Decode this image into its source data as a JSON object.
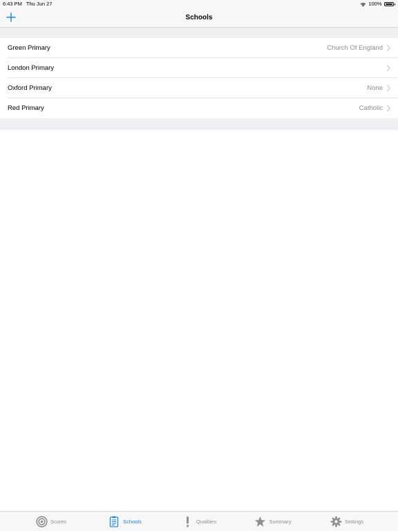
{
  "status_bar": {
    "time": "6:43 PM",
    "date": "Thu Jun 27",
    "battery_percent": "100%",
    "battery_level": 1.0
  },
  "nav": {
    "title": "Schools",
    "add_icon": "plus-icon"
  },
  "schools": [
    {
      "name": "Green Primary",
      "detail": "Church Of England"
    },
    {
      "name": "London Primary",
      "detail": ""
    },
    {
      "name": "Oxford Primary",
      "detail": "None"
    },
    {
      "name": "Red Primary",
      "detail": "Catholic"
    }
  ],
  "tabs": [
    {
      "label": "Scores",
      "icon": "target-icon",
      "active": false
    },
    {
      "label": "Schools",
      "icon": "clipboard-icon",
      "active": true
    },
    {
      "label": "Qualities",
      "icon": "exclamation-icon",
      "active": false
    },
    {
      "label": "Summary",
      "icon": "star-icon",
      "active": false
    },
    {
      "label": "Settings",
      "icon": "gear-icon",
      "active": false
    }
  ],
  "colors": {
    "accent": "#1a82e2",
    "inactive": "#8e8e93",
    "group_background": "#efeff4",
    "bar_background": "#f7f7f7"
  }
}
